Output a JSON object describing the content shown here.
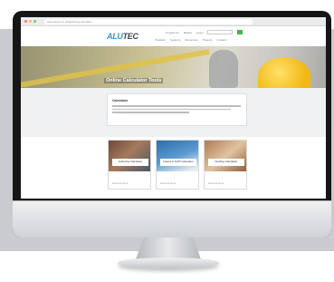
{
  "browser": {
    "url": "www.alutec.co.uk/guttering-calculator"
  },
  "header": {
    "logo_main": "ALU",
    "logo_accent": "TEC",
    "utility": [
      "Contact Us",
      "Basket",
      "Login"
    ],
    "nav": [
      "Products",
      "Systems",
      "Resources",
      "Projects",
      "Contact"
    ]
  },
  "hero": {
    "title": "Online Calculator Tools"
  },
  "intro": {
    "title": "Calculator"
  },
  "tiles": [
    {
      "label": "Guttering Calculator",
      "link": "Find out more"
    },
    {
      "label": "Fascia & Soffit Calculator",
      "link": "Find out more"
    },
    {
      "label": "Roofing Calculator",
      "link": "Find out more"
    }
  ],
  "colors": {
    "accent": "#2d8fc9",
    "button": "#47b649",
    "hero_beam": "#e1c238"
  }
}
